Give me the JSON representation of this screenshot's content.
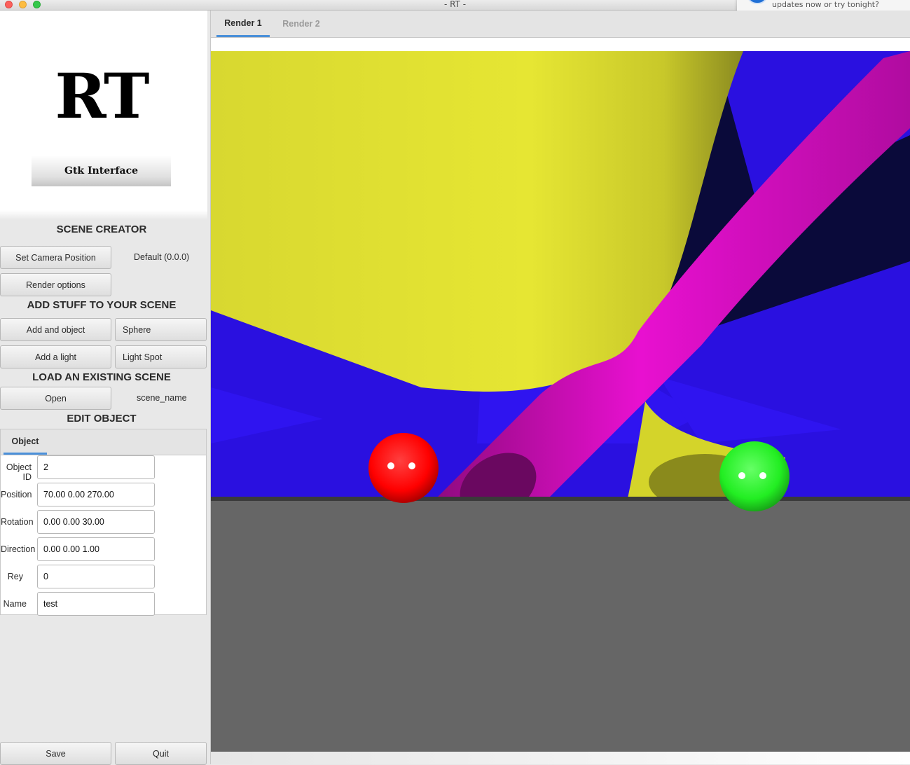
{
  "window": {
    "title": "- RT -"
  },
  "notification": {
    "text": "updates now or try tonight?"
  },
  "logo": {
    "text": "RT",
    "subtitle": "Gtk Interface"
  },
  "scene_creator": {
    "heading": "SCENE CREATOR",
    "camera_button": "Set Camera Position",
    "camera_value": "Default (0.0.0)",
    "render_options_button": "Render options"
  },
  "add_stuff": {
    "heading": "ADD STUFF TO YOUR SCENE",
    "add_object_button": "Add and object",
    "object_type": "Sphere",
    "add_light_button": "Add a light",
    "light_type": "Light Spot"
  },
  "load_scene": {
    "heading": "LOAD AN EXISTING SCENE",
    "open_button": "Open",
    "scene_name": "scene_name"
  },
  "edit_object": {
    "heading": "EDIT OBJECT",
    "tab_label": "Object",
    "fields": [
      {
        "label": "Object ID",
        "value": "2"
      },
      {
        "label": "Position",
        "value": "70.00 0.00 270.00"
      },
      {
        "label": "Rotation",
        "value": "0.00 0.00 30.00"
      },
      {
        "label": "Direction",
        "value": "0.00 0.00 1.00"
      },
      {
        "label": "Rey",
        "value": "0"
      },
      {
        "label": "Name",
        "value": "test"
      }
    ]
  },
  "footer": {
    "save_button": "Save",
    "quit_button": "Quit"
  },
  "render_tabs": [
    {
      "label": "Render 1",
      "active": true
    },
    {
      "label": "Render 2",
      "active": false
    }
  ],
  "colors": {
    "accent": "#4a90d9",
    "background_plane": "#2a10e0",
    "cone": "#e0e030",
    "cylinder": "#e010c8",
    "floor": "#666666",
    "red_sphere": "#ff0000",
    "green_sphere": "#22ee22"
  }
}
